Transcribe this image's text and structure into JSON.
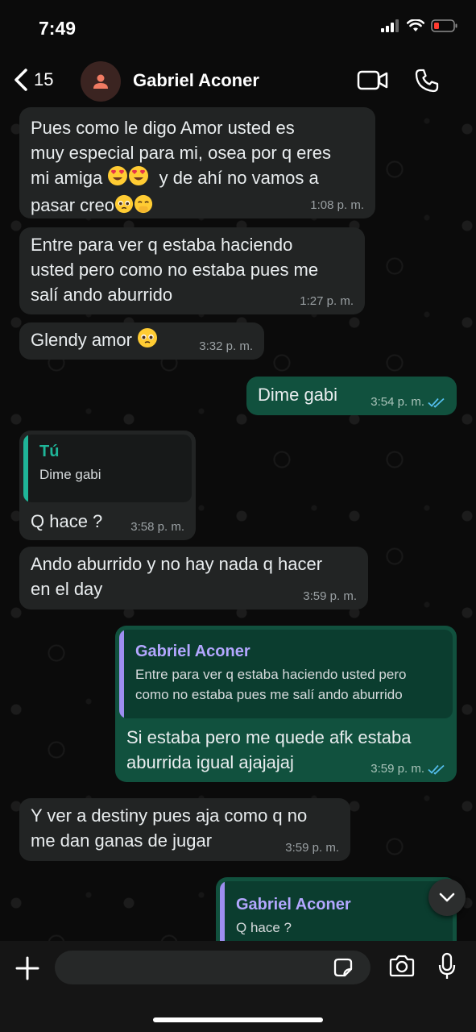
{
  "status_bar": {
    "time": "7:49"
  },
  "header": {
    "back_count": "15",
    "contact_name": "Gabriel Aconer"
  },
  "messages": [
    {
      "direction": "in",
      "text": "Pues como le digo Amor usted es\nmuy especial para mi, osea por q eres\nmi amiga",
      "text_tail": "y de ahí no vamos a\npasar creo",
      "time": "1:08 p. m."
    },
    {
      "direction": "in",
      "text": "Entre para ver q estaba haciendo\nusted pero como no estaba pues me\nsalí ando aburrido",
      "time": "1:27 p. m."
    },
    {
      "direction": "in",
      "text": "Glendy amor",
      "time": "3:32 p. m."
    },
    {
      "direction": "out",
      "text": "Dime gabi",
      "time": "3:54 p. m."
    },
    {
      "direction": "in",
      "quote_author": "Tú",
      "quote_text": "Dime gabi",
      "text": "Q hace ?",
      "time": "3:58 p. m."
    },
    {
      "direction": "in",
      "text": "Ando aburrido y no hay nada q hacer\nen el day",
      "time": "3:59 p. m."
    },
    {
      "direction": "out",
      "quote_author": "Gabriel Aconer",
      "quote_text": "Entre para ver q estaba haciendo usted pero\ncomo no estaba pues me salí ando aburrido",
      "text": "Si estaba pero me quede afk estaba\naburrida igual ajajajaj",
      "time": "3:59 p. m."
    },
    {
      "direction": "in",
      "text": "Y ver a destiny pues aja como q no\nme dan ganas de jugar",
      "time": "3:59 p. m."
    },
    {
      "direction": "out",
      "quote_author": "Gabriel Aconer",
      "quote_text": "Q hace ?"
    }
  ],
  "input": {
    "placeholder": ""
  },
  "colors": {
    "incoming_bubble": "#222424",
    "outgoing_bubble": "#11513e",
    "read_ticks": "#53bdeb",
    "quote_teal": "#1fb598",
    "quote_purple": "#b3a7ff"
  },
  "icons": [
    "back-chevron-icon",
    "person-icon",
    "video-call-icon",
    "phone-icon",
    "chevron-down-icon",
    "plus-icon",
    "sticker-icon",
    "camera-icon",
    "microphone-icon"
  ]
}
